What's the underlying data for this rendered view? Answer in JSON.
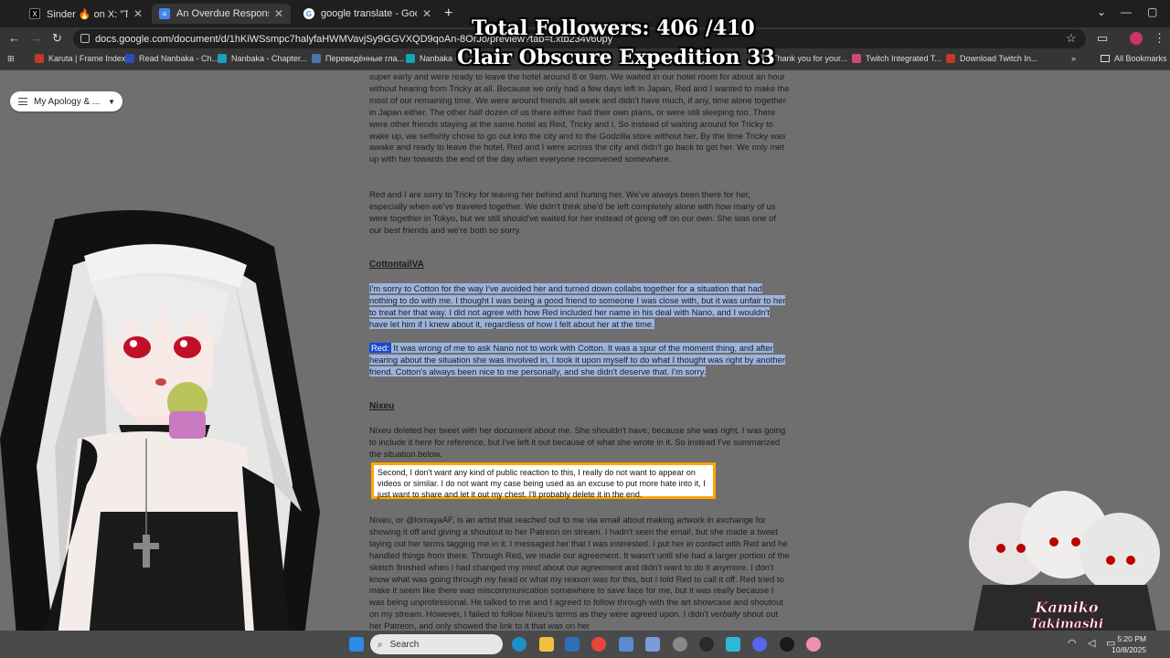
{
  "browser": {
    "tabs": [
      {
        "title": "Sinder 🔥 on X: \"The burden of",
        "icon": "x-logo-icon",
        "active": false
      },
      {
        "title": "An Overdue Response - Google",
        "icon": "google-docs-icon",
        "active": true
      },
      {
        "title": "google translate - Google Sear",
        "icon": "google-icon",
        "active": false
      }
    ],
    "new_tab": "+",
    "url": "docs.google.com/document/d/1hKiWSsmpc7halyfaHWMVavjSy9GGVXQD9qoAn-8OrJo/preview?tab=t.xtb234v60py",
    "bookmarks": [
      {
        "label": "Karuta | Frame Index",
        "color": "#c0392b"
      },
      {
        "label": "Read Nanbaka - Ch...",
        "color": "#2d4fb3"
      },
      {
        "label": "Nanbaka - Chapter...",
        "color": "#17a2b8"
      },
      {
        "label": "Переведённые гла...",
        "color": "#4a76a8"
      },
      {
        "label": "Nanbaka - ",
        "color": "#17a2b8"
      },
      {
        "label": "Thank you for your...",
        "color": "#777"
      },
      {
        "label": "Twitch Integrated T...",
        "color": "#d1477a"
      },
      {
        "label": "Download Twitch In...",
        "color": "#c0392b"
      }
    ],
    "all_bookmarks": "All Bookmarks"
  },
  "overlay": {
    "line1": "Total Followers: 406 /410",
    "line2": "Clair Obscure Expedition 33"
  },
  "outline": {
    "label": "My Apology & ..."
  },
  "document": {
    "p1": "super early and were ready to leave the hotel around 8 or 9am. We waited in our hotel room for about an hour without hearing from Tricky at all. Because we only had a few days left in Japan, Red and I wanted to make the most of our remaining time. We were around friends all week and didn't have much, if any, time alone together in Japan either. The other half dozen of us there either had their own plans, or were still sleeping too. There were other friends staying at the same hotel as Red, Tricky and I. So instead of waiting around for Tricky to wake up, we selfishly chose to go out into the city and to the Godzilla store without her. By the time Tricky was awake and ready to leave the hotel, Red and I were across the city and didn't go back to get her. We only met up with her towards the end of the day when everyone reconvened somewhere.",
    "p2": "Red and I are sorry to Tricky for leaving her behind and hurting her. We've always been there for her, especially when we've traveled together. We didn't think she'd be left completely alone with how many of us were together in Tokyo, but we still should've waited for her instead of going off on our own. She was one of our best friends and we're both so sorry.",
    "h_cotton": "CottontailVA",
    "p3": "I'm sorry to Cotton for the way I've avoided her and turned down collabs together for a situation that had nothing to do with me. I thought I was being a good friend to someone I was close with, but it was unfair to her to treat her that way. I did not agree with how Red included her name in his deal with Nano, and I wouldn't have let him if I knew about it, regardless of how I felt about her at the time.",
    "p4_label": "Red:",
    "p4": " It was wrong of me to ask Nano not to work with Cotton. It was a spur of the moment thing, and after hearing about the situation she was involved in, I took it upon myself to do what I thought was right by another friend. Cotton's always been nice to me personally, and she didn't deserve that. I'm sorry.",
    "h_nixeu": "Nixeu",
    "p5": "Nixeu deleted her tweet with her document about me. She shouldn't have, because she was right. I was going to include it here for reference, but I've left it out because of what she wrote in it. So instead I've summarized the situation below.",
    "quote": "Second, I don't want any kind of public reaction to this, I really do not want to appear on videos or similar. I do not want my case being used as an excuse to put more hate into it, I just want to share and let it out my chest. I'll probably delete it in the end.",
    "p6_a": "Nixeu, or @lomayaAF, is an artist that reached out to me via email about making artwork in exchange for showing it off and giving a shoutout to her Patreon on stream. I hadn't seen the email, but she made a tweet laying out her terms tagging me in it. I messaged her that I was interested. I put her in contact with Red and he handled things from there. Through Red, we made our agreement. It wasn't until she had a larger portion of the sketch finished when I had changed my mind about our agreement and didn't want to do it anymore. I don't know what was going through my head or what my reason was for this, but I told Red to call it off. Red tried to make it seem like there was miscommunication somewhere to save face for me, but it was really because I was being unprofessional. He talked to me and I agreed to follow through with the art showcase and shoutout on my stream. However, I failed to follow Nixeu's terms as they were agreed upon. I didn't ",
    "p6_em": "verbally",
    "p6_b": " shout out her Patreon, and only showed the link to it that was on her"
  },
  "watermark": "Kamiko Takimashi",
  "taskbar": {
    "search_placeholder": "Search",
    "time": "5:20 PM",
    "date": "10/8/2025"
  }
}
